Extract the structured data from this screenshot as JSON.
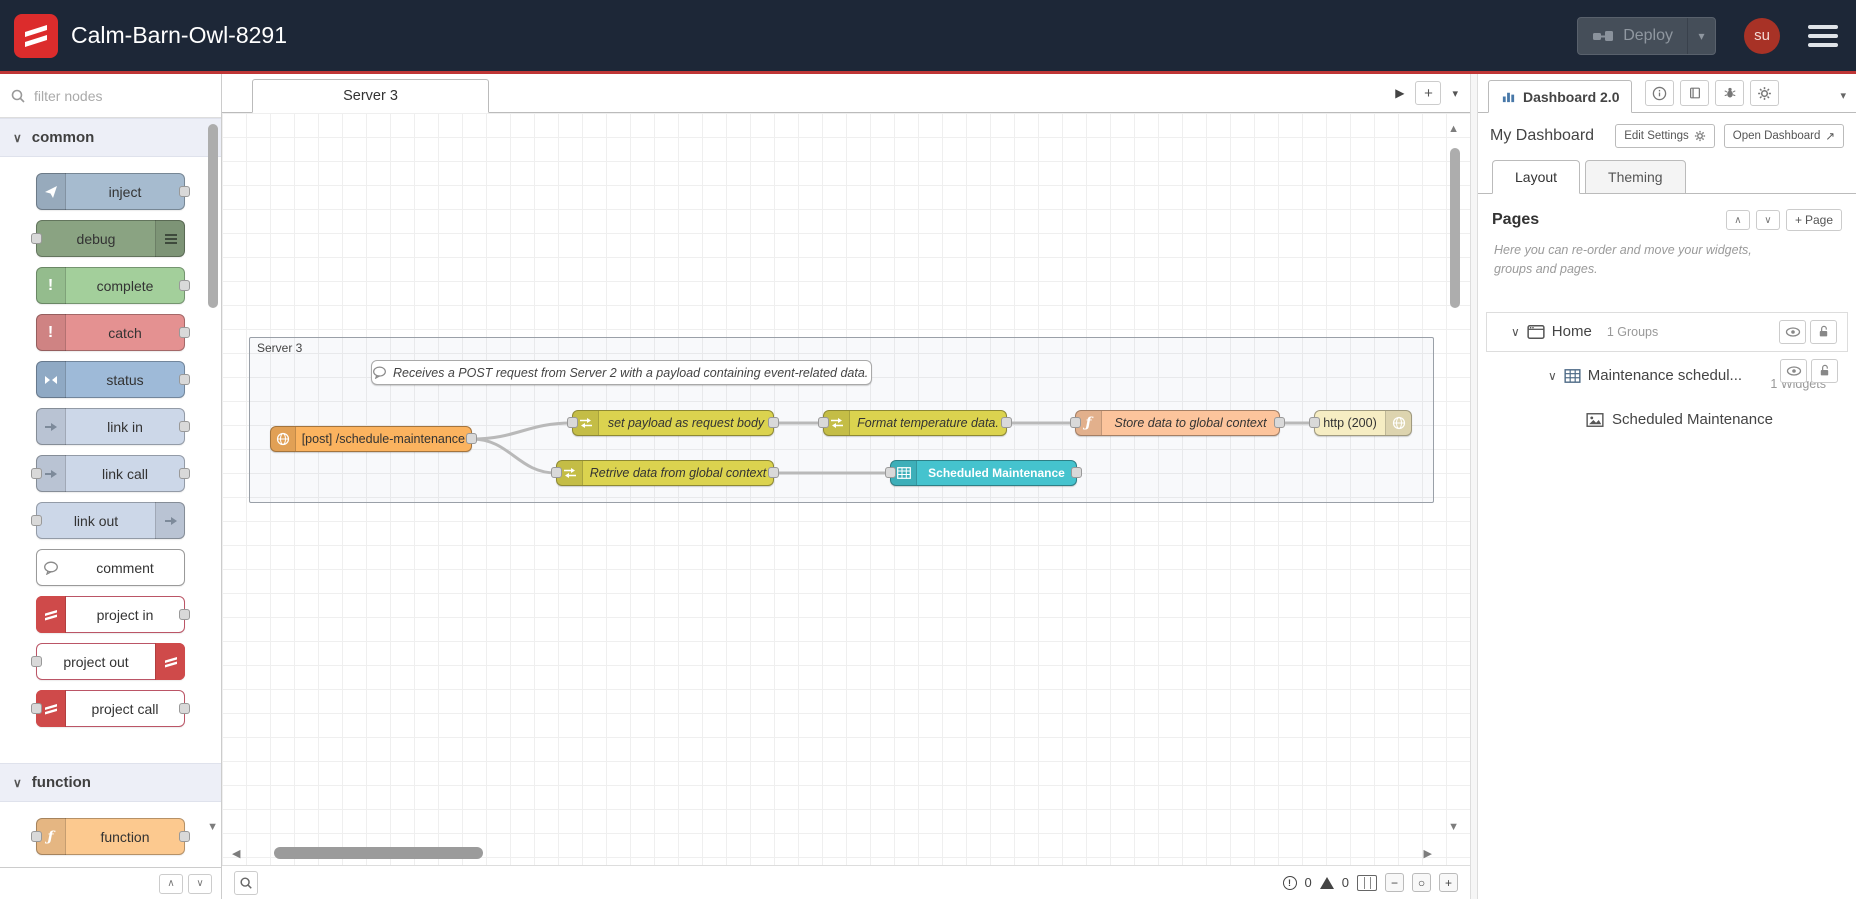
{
  "header": {
    "title": "Calm-Barn-Owl-8291",
    "deploy": {
      "label": "Deploy"
    },
    "user": {
      "initials": "su"
    }
  },
  "palette": {
    "search_placeholder": "filter nodes",
    "categories": [
      {
        "label": "common",
        "nodes": [
          {
            "label": "inject",
            "color": "#a6bbcf"
          },
          {
            "label": "debug",
            "color": "#8aa382"
          },
          {
            "label": "complete",
            "color": "#a3cf9b"
          },
          {
            "label": "catch",
            "color": "#e49191"
          },
          {
            "label": "status",
            "color": "#9ebad8"
          },
          {
            "label": "link in",
            "color": "#ccd7e8"
          },
          {
            "label": "link call",
            "color": "#ccd7e8"
          },
          {
            "label": "link out",
            "color": "#ccd7e8"
          },
          {
            "label": "comment",
            "color": "#ffffff"
          },
          {
            "label": "project in",
            "color": "#ffffff"
          },
          {
            "label": "project out",
            "color": "#ffffff"
          },
          {
            "label": "project call",
            "color": "#ffffff"
          }
        ]
      },
      {
        "label": "function",
        "nodes": [
          {
            "label": "function",
            "color": "#fcc98f"
          }
        ]
      }
    ]
  },
  "workspace": {
    "tab": "Server 3",
    "group_label": "Server 3",
    "comment": "Receives a POST request from Server 2 with a payload containing event-related data.",
    "nodes": {
      "http_in": {
        "label": "[post] /schedule-maintenance",
        "color": "#fbb35f"
      },
      "set_payload": {
        "label": "set payload as request body",
        "color": "#dbd34f"
      },
      "format_temp": {
        "label": "Format temperature data.",
        "color": "#dbd34f"
      },
      "store_global": {
        "label": "Store data to global context",
        "color": "#fcc49c"
      },
      "http_response": {
        "label": "http (200)",
        "color": "#f6edc3"
      },
      "retrieve_global": {
        "label": "Retrive data from global context",
        "color": "#dbd34f"
      },
      "ui_table": {
        "label": "Scheduled Maintenance",
        "color": "#45c3ce"
      }
    }
  },
  "sidebar": {
    "active_tab": "Dashboard 2.0",
    "dashboard_name": "My Dashboard",
    "buttons": {
      "edit_settings": "Edit Settings",
      "open_dashboard": "Open Dashboard"
    },
    "tabs": {
      "layout": "Layout",
      "theming": "Theming"
    },
    "pages": {
      "heading": "Pages",
      "add_page": "Page",
      "help": "Here you can re-order and move your widgets, groups and pages.",
      "tree": {
        "page": {
          "label": "Home",
          "meta": "1 Groups"
        },
        "group": {
          "label": "Maintenance schedul...",
          "meta": "1 Widgets"
        },
        "widget": {
          "label": "Scheduled Maintenance"
        }
      }
    }
  },
  "statusbar": {
    "errors": "0",
    "warnings": "0",
    "zoom_out": "−",
    "zoom_reset": "○",
    "zoom_in": "+"
  },
  "icons": {
    "chevron_down": "∨",
    "chevron_up": "∧",
    "caret_down": "▾",
    "play": "▶",
    "plus": "+",
    "scroll_left": "◀",
    "scroll_right": "▶",
    "scroll_up": "▲",
    "scroll_down": "▼",
    "external_link": "↗",
    "exclamation": "!"
  },
  "colors": {
    "header_bg": "#1d2737",
    "brand_red": "#dc2c2c",
    "accent_line": "#bf3636",
    "avatar_bg": "#a83226",
    "table_teal": "#45c3ce"
  }
}
